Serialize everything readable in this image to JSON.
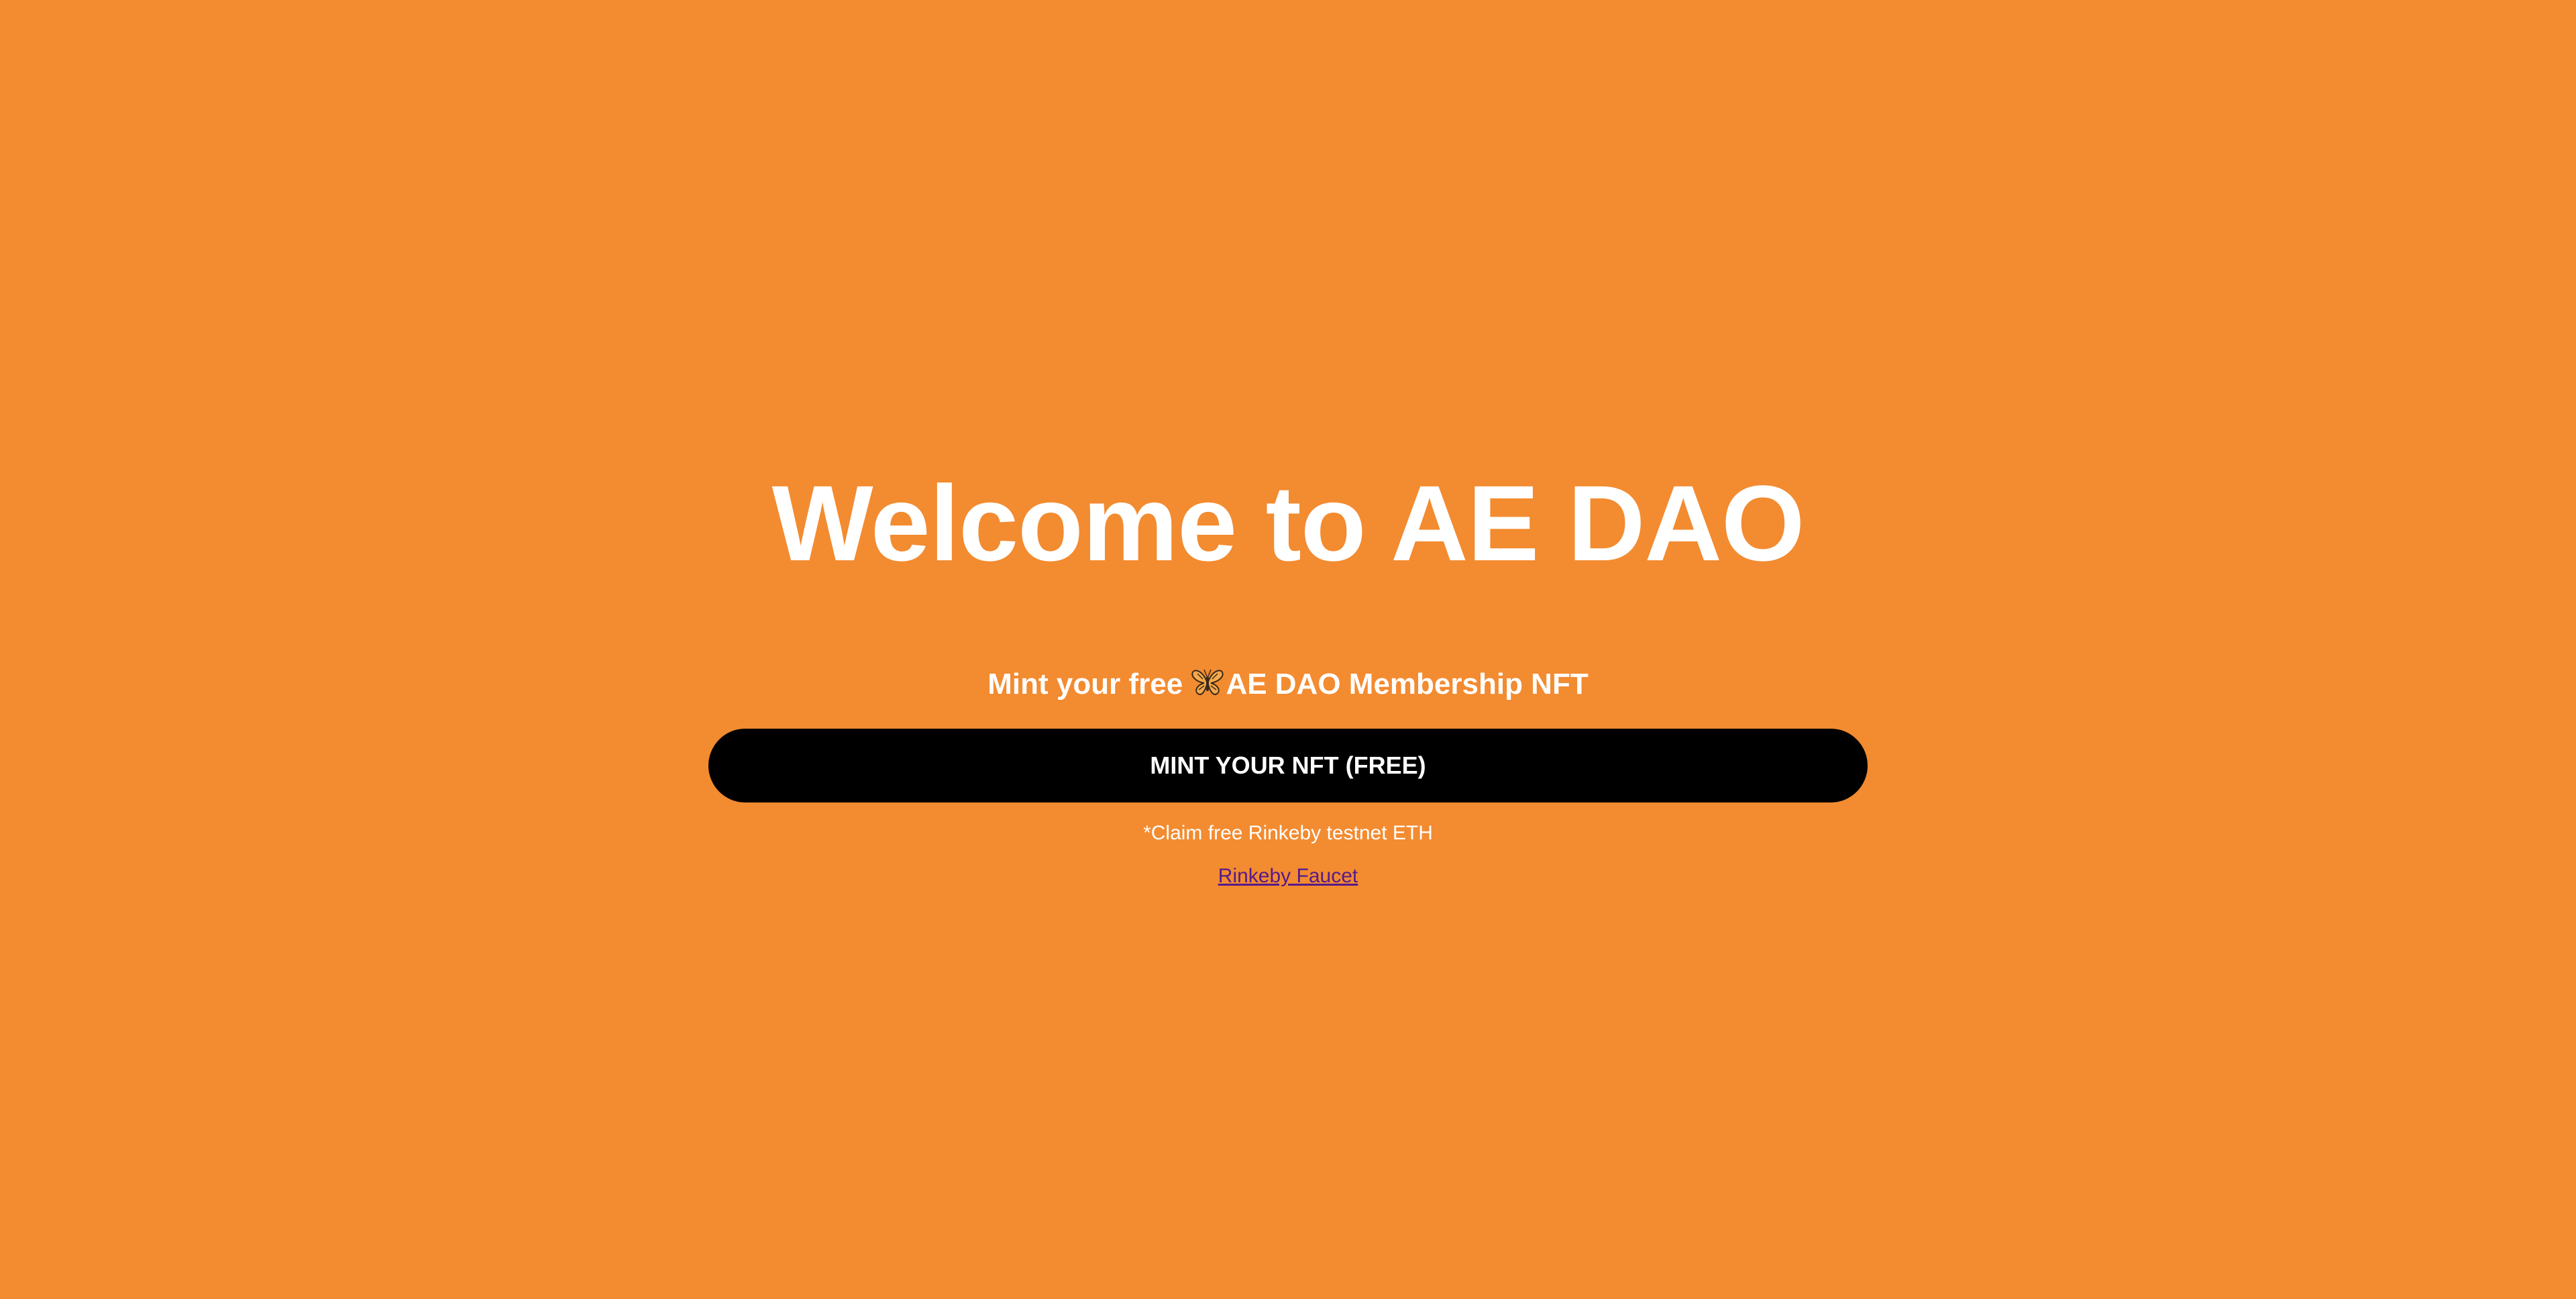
{
  "header": {
    "title": "Welcome to AE DAO"
  },
  "mint": {
    "subtitle_prefix": "Mint your free ",
    "subtitle_icon": "butterfly-icon",
    "subtitle_suffix": "AE DAO Membership NFT",
    "button_label": "MINT YOUR NFT (FREE)"
  },
  "footer": {
    "note": "*Claim free Rinkeby testnet ETH",
    "link_label": "Rinkeby Faucet"
  },
  "colors": {
    "background": "#F38B30",
    "button": "#000000",
    "text": "#FFFFFF",
    "link": "#551A8B"
  }
}
